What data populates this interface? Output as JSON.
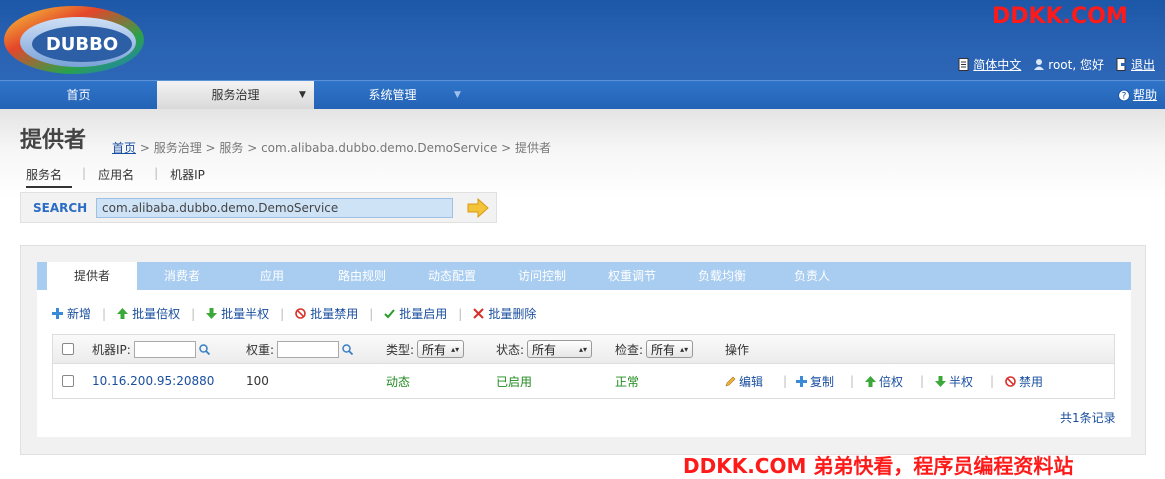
{
  "brand": {
    "logo_text": "DUBBO",
    "watermark": "DDKK.COM"
  },
  "toplinks": {
    "language": "简体中文",
    "user": "root, 您好",
    "logout": "退出"
  },
  "nav": {
    "items": [
      {
        "label": "首页"
      },
      {
        "label": "服务治理"
      },
      {
        "label": "系统管理"
      }
    ],
    "help": "帮助"
  },
  "page": {
    "title": "提供者",
    "breadcrumb": {
      "home": "首页",
      "rest": " > 服务治理 > 服务 > com.alibaba.dubbo.demo.DemoService > 提供者"
    }
  },
  "search": {
    "tabs": [
      "服务名",
      "应用名",
      "机器IP"
    ],
    "label": "SEARCH",
    "value": "com.alibaba.dubbo.demo.DemoService"
  },
  "tabs": [
    "提供者",
    "消费者",
    "应用",
    "路由规则",
    "动态配置",
    "访问控制",
    "权重调节",
    "负载均衡",
    "负责人"
  ],
  "actions": [
    {
      "label": "新增",
      "icon": "plus-icon"
    },
    {
      "label": "批量倍权",
      "icon": "arrow-up-icon"
    },
    {
      "label": "批量半权",
      "icon": "arrow-down-icon"
    },
    {
      "label": "批量禁用",
      "icon": "ban-icon"
    },
    {
      "label": "批量启用",
      "icon": "check-icon"
    },
    {
      "label": "批量删除",
      "icon": "cross-icon"
    }
  ],
  "table": {
    "headers": {
      "ip": "机器IP:",
      "weight": "权重:",
      "type": "类型:",
      "status": "状态:",
      "check": "检查:",
      "ops": "操作"
    },
    "filters": {
      "type": "所有",
      "status": "所有",
      "check": "所有"
    },
    "rows": [
      {
        "address": "10.16.200.95:20880",
        "weight": "100",
        "type": "动态",
        "status": "已启用",
        "check": "正常",
        "ops": [
          "编辑",
          "复制",
          "倍权",
          "半权",
          "禁用"
        ]
      }
    ],
    "count": "共1条记录"
  },
  "footer_watermark": "DDKK.COM 弟弟快看，程序员编程资料站",
  "colors": {
    "header": "#2a63b3",
    "tab_bar": "#a9cdf0",
    "link": "#1a4fa0",
    "ok_green": "#1f8a1f",
    "watermark": "#ff1a1a"
  }
}
